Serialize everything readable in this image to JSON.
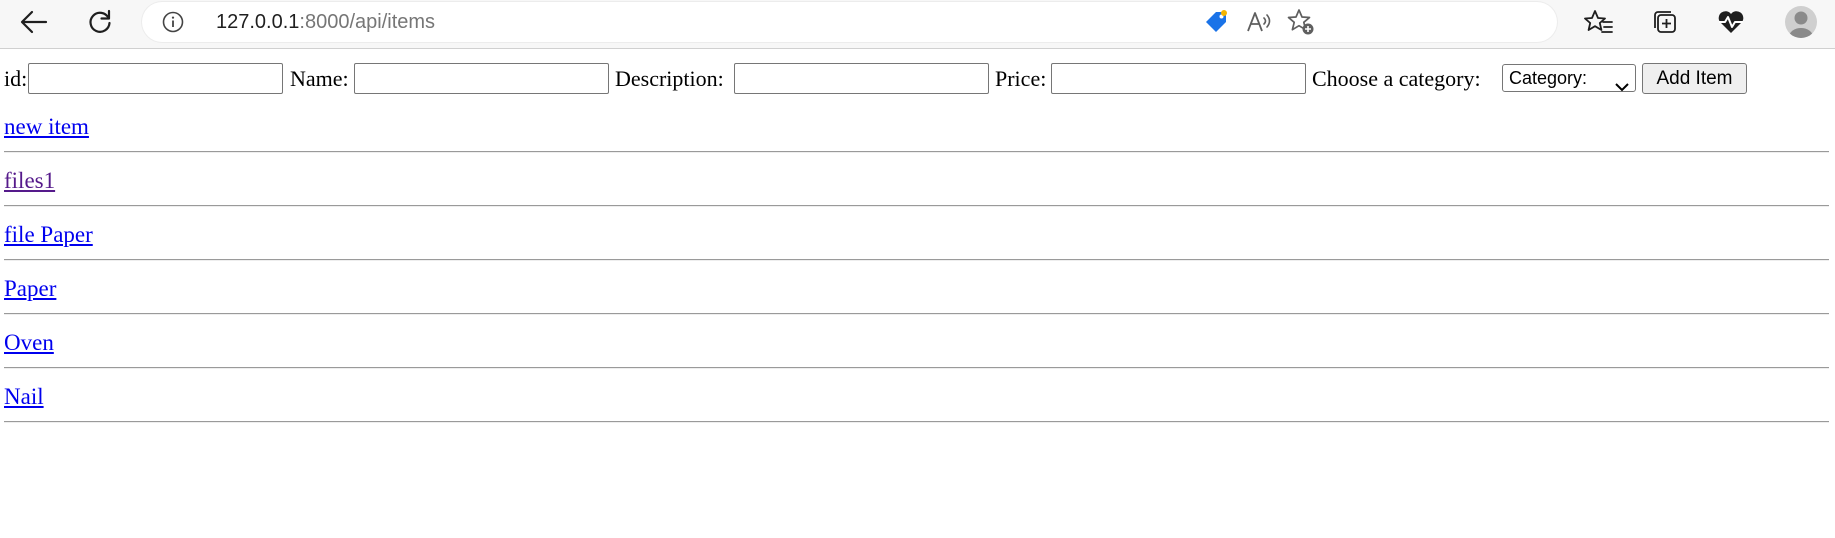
{
  "browser": {
    "url_host": "127.0.0.1",
    "url_path": ":8000/api/items",
    "icons": [
      "back-arrow-icon",
      "refresh-icon",
      "info-icon",
      "shopping-tag-icon",
      "read-aloud-icon",
      "add-favorite-icon",
      "favorites-icon",
      "collections-icon",
      "health-icon",
      "profile-icon"
    ],
    "accent_color": "#1a73e8"
  },
  "form": {
    "id_label": "id:",
    "name_label": "Name:",
    "description_label": "Description:",
    "price_label": "Price:",
    "category_label": "Choose a category:",
    "category_selected": "Category:",
    "add_button_label": "Add Item",
    "id_value": "",
    "name_value": "",
    "description_value": "",
    "price_value": ""
  },
  "items": [
    {
      "label": "new item",
      "visited": false
    },
    {
      "label": "files1",
      "visited": true
    },
    {
      "label": "file Paper",
      "visited": false
    },
    {
      "label": "Paper",
      "visited": false
    },
    {
      "label": "Oven",
      "visited": false
    },
    {
      "label": "Nail",
      "visited": false
    }
  ],
  "colors": {
    "link": "#0000ee",
    "visited_link": "#551a8b"
  }
}
